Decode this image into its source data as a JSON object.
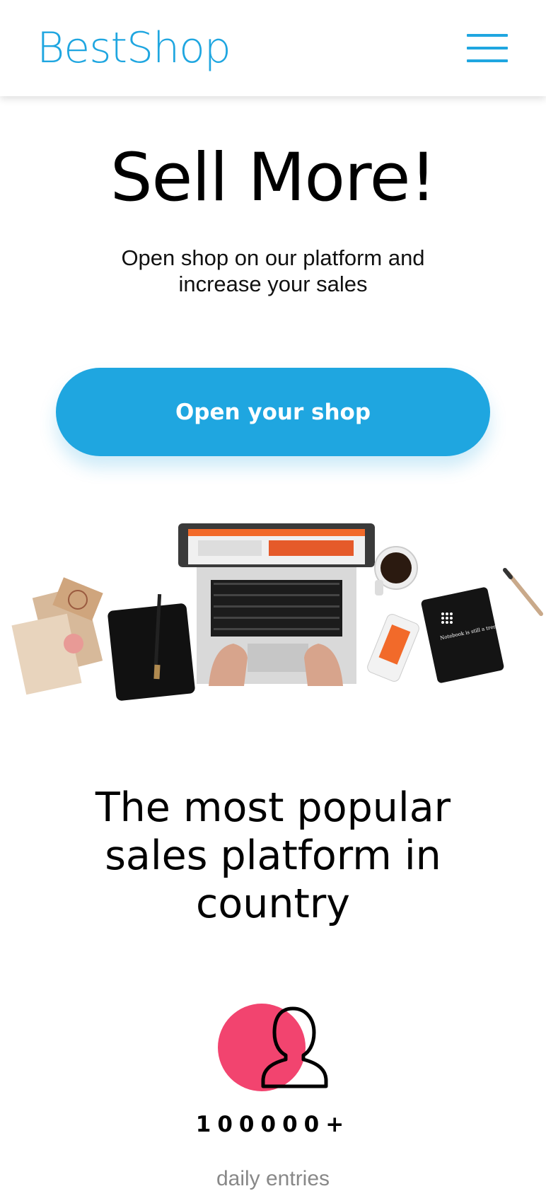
{
  "header": {
    "logo": "BestShop",
    "menu_icon": "hamburger-menu-icon"
  },
  "hero": {
    "title": "Sell More!",
    "subtitle": "Open shop on our platform and increase your sales",
    "cta_label": "Open your shop"
  },
  "illustration": {
    "notebook_text": "Notebook is still a trend"
  },
  "section": {
    "title": "The most popular sales platform in country"
  },
  "stats": [
    {
      "icon": "user-icon",
      "value": "100000+",
      "label": "daily entries"
    }
  ],
  "colors": {
    "brand": "#1fa6e0",
    "accent": "#f2446f"
  }
}
